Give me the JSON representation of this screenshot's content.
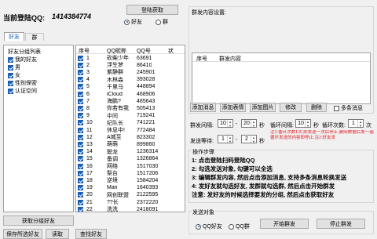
{
  "header": {
    "account_label": "当前登陆QQ:",
    "account_value": "1414384774",
    "login_button": "登陆获取",
    "target_options": [
      "好友",
      "群"
    ],
    "target_selected": 0
  },
  "left": {
    "tabs": [
      "好友",
      "群"
    ],
    "active_tab": 0,
    "group_list_title": "好友分组列表",
    "groups": [
      {
        "label": "我的好友",
        "checked": true
      },
      {
        "label": "男",
        "checked": true
      },
      {
        "label": "女",
        "checked": true
      },
      {
        "label": "性别保密",
        "checked": true
      },
      {
        "label": "认证空间",
        "checked": true
      }
    ],
    "get_groups_button": "获取分组好友",
    "save_button": "保存所选好友",
    "read_button": "读取",
    "query_button": "查找好友"
  },
  "friends": {
    "columns": [
      "序号",
      "QQ昵称",
      "QQ号",
      "状"
    ],
    "rows": [
      {
        "no": "1",
        "nick": "砍柴少年",
        "qq": "63691"
      },
      {
        "no": "2",
        "nick": "浮生梦",
        "qq": "86410"
      },
      {
        "no": "3",
        "nick": "紫静群",
        "qq": "245901"
      },
      {
        "no": "4",
        "nick": "木林森",
        "qq": "393028"
      },
      {
        "no": "5",
        "nick": "千里马",
        "qq": "448894"
      },
      {
        "no": "6",
        "nick": "iCloud",
        "qq": "468906"
      },
      {
        "no": "7",
        "nick": "海鹏?",
        "qq": "485643"
      },
      {
        "no": "8",
        "nick": "你若有我",
        "qq": "505413"
      },
      {
        "no": "9",
        "nick": "中间",
        "qq": "719241"
      },
      {
        "no": "10",
        "nick": "纪队长",
        "qq": "741221"
      },
      {
        "no": "11",
        "nick": "休息中!",
        "qq": "772484"
      },
      {
        "no": "12",
        "nick": "A城至",
        "qq": "823302"
      },
      {
        "no": "13",
        "nick": "萌萌",
        "qq": "899860"
      },
      {
        "no": "14",
        "nick": "聪龙",
        "qq": "1236314"
      },
      {
        "no": "15",
        "nick": "备调",
        "qq": "1326864"
      },
      {
        "no": "16",
        "nick": "网络",
        "qq": "1517030"
      },
      {
        "no": "17",
        "nick": "梨台",
        "qq": "1517206"
      },
      {
        "no": "18",
        "nick": "逆境",
        "qq": "1584204"
      },
      {
        "no": "19",
        "nick": "Mari",
        "qq": "1640393"
      },
      {
        "no": "20",
        "nick": "网创联盟",
        "qq": "2122595"
      },
      {
        "no": "21",
        "nick": "??长",
        "qq": "2372220"
      },
      {
        "no": "22",
        "nick": "洗洗",
        "qq": "2418091"
      }
    ]
  },
  "right": {
    "content_settings_title": "群发内容设置:",
    "content_columns": [
      "序号",
      "群发内容"
    ],
    "buttons": {
      "add_message": "添加消息",
      "add_emoji": "添加表情",
      "add_image": "添加图片",
      "edit": "修改",
      "delete": "删除"
    },
    "multi_message_label": "多条消息",
    "multi_message_checked": false,
    "interval_label": "群发间隔:",
    "interval_from": "10",
    "interval_sep": "-",
    "interval_to": "20",
    "interval_unit": "秒",
    "loop_label": "循环间隔:",
    "loop_value": "10",
    "loop_unit": "秒",
    "loop_count_label": "循环次数:",
    "loop_count_value": "1",
    "loop_count_unit": "次",
    "wait_label": "发送等待:",
    "wait_from": "1",
    "wait_sep": "-",
    "wait_to": "2",
    "wait_unit": "秒",
    "note_text": "注1:循环次数1次,即发送一次后停止,删除数据后发一遍循环发送的内容即停止,注2:好友发",
    "note_color": "#e01b24",
    "steps_title": "操作步骤",
    "steps": [
      "1: 点击登陆扫码登陆QQ",
      "2: 勾选发送对象, 勾键可以全选",
      "3: 编辑群发内容, 然后点击添加消息, 支持多条消息轮换发送",
      "4: 发好友就勾选好友, 发群就勾选群, 然后点击开始群发",
      "注意: 发好友的时候选择要发的分组, 然后点击获取好友"
    ],
    "send_target_label": "发送对象",
    "send_target_options": [
      "QQ好友",
      "QQ群"
    ],
    "send_target_selected": 0,
    "start_button": "开始群发",
    "stop_button": "停止群发"
  }
}
